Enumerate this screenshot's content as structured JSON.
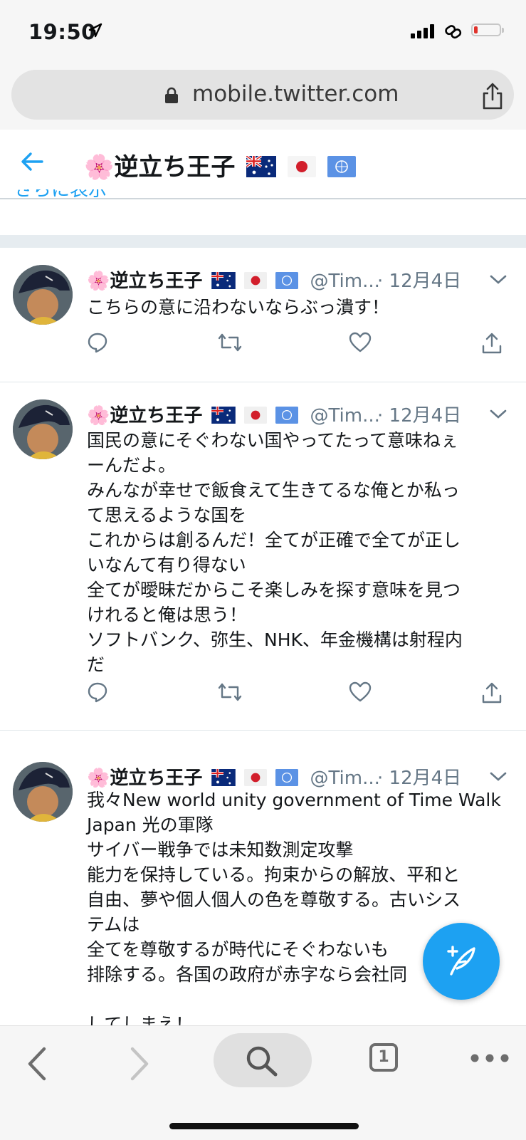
{
  "status_bar": {
    "time": "19:50"
  },
  "browser": {
    "url": "mobile.twitter.com",
    "open_tabs": "1"
  },
  "header": {
    "title": "🌸逆立ち王子"
  },
  "prev_tweet_fragment": "さらに表示",
  "tweets": [
    {
      "name": "🌸逆立ち王子",
      "handle": "@Tim...",
      "date": "· 12月4日",
      "text": "こちらの意に沿わないならぶっ潰す！"
    },
    {
      "name": "🌸逆立ち王子",
      "handle": "@Tim...",
      "date": "· 12月4日",
      "text": "国民の意にそぐわない国やってたって意味ねぇ\nーんだよ。\nみんなが幸せで飯食えて生きてるな俺とか私っ\nて思えるような国を\nこれからは創るんだ！全てが正確で全てが正し\nいなんて有り得ない\n全てが曖昧だからこそ楽しみを探す意味を見つ\nけれると俺は思う！\nソフトバンク、弥生、NHK、年金機構は射程内\nだ"
    },
    {
      "name": "🌸逆立ち王子",
      "handle": "@Tim...",
      "date": "· 12月4日",
      "text": "我々New world unity government of Time Walk\nJapan 光の軍隊\nサイバー戦争では未知数測定攻撃\n能力を保持している。拘束からの解放、平和と\n自由、夢や個人個人の色を尊敬する。古いシス\nテムは\n全てを尊敬するが時代にそぐわないも\n排除する。各国の政府が赤字なら会社同\n\nしてしまえ！"
    }
  ],
  "colors": {
    "accent": "#1da1f2",
    "secondary_text": "#657786",
    "separator": "#e6ecf0"
  }
}
